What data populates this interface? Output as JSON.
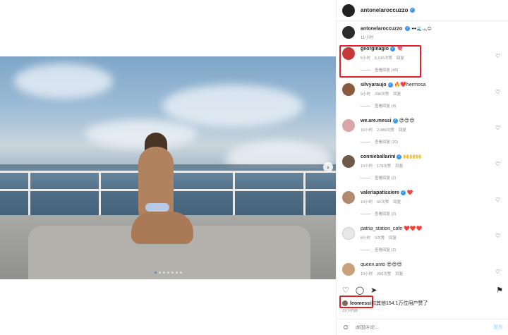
{
  "header": {
    "username": "antonelaroccuzzo"
  },
  "caption": {
    "username": "antonelaroccuzzo",
    "emojis": "🕶️🌊🛥️😌",
    "time": "11小时"
  },
  "comments": [
    {
      "username": "georginagio",
      "text": "💘",
      "time": "5小时",
      "likes": "5,015次赞",
      "reply": "回复",
      "view_replies": "查看回复 (48)"
    },
    {
      "username": "silvyaraujo",
      "text": "🔥❤️hermosa",
      "time": "9小时",
      "likes": "298次赞",
      "reply": "回复",
      "view_replies": "查看回复 (4)"
    },
    {
      "username": "we.are.messi",
      "text": "😍😍😍",
      "time": "10小时",
      "likes": "2,089次赞",
      "reply": "回复",
      "view_replies": "查看回复 (20)"
    },
    {
      "username": "connieballarini",
      "text": "🙌🙌🙌",
      "time": "10小时",
      "likes": "178次赞",
      "reply": "回复",
      "view_replies": "查看回复 (2)"
    },
    {
      "username": "valeriapatissiere",
      "text": "❤️",
      "time": "10小时",
      "likes": "60次赞",
      "reply": "回复",
      "view_replies": "查看回复 (2)"
    },
    {
      "username": "patria_station_cafe",
      "text": "❤️❤️❤️",
      "time": "8小时",
      "likes": "9次赞",
      "reply": "回复",
      "view_replies": "查看回复 (2)"
    },
    {
      "username": "queen.anto",
      "text": "😍😍😍",
      "time": "10小时",
      "likes": "206次赞",
      "reply": "回复",
      "view_replies": ""
    }
  ],
  "likes": {
    "user": "leomessi",
    "rest": "和其他154.1万位用户赞了"
  },
  "post_time": "11小时前",
  "comment_box": {
    "placeholder": "添加评论...",
    "post_label": "发布"
  },
  "carousel": {
    "total_slides": 7,
    "active_index": 0
  },
  "colors": {
    "verified": "#3897f0",
    "highlight": "#e0202a",
    "post_button": "#b2dffc"
  }
}
